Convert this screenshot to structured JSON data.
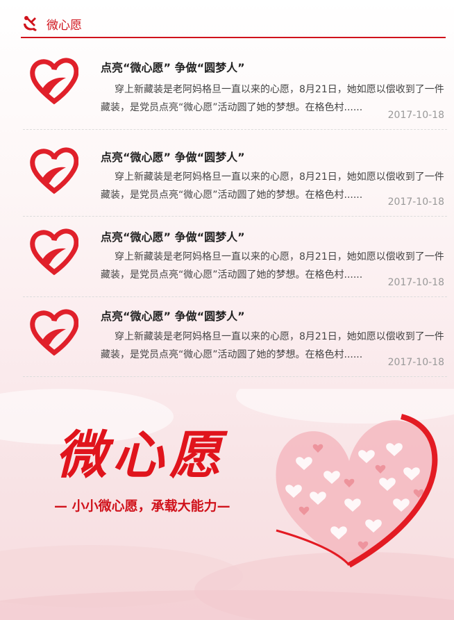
{
  "header": {
    "title": "微心愿",
    "icon": "party-emblem-icon",
    "accent": "#d0121b"
  },
  "items": [
    {
      "title": "点亮“微心愿” 争做“圆梦人”",
      "desc": "穿上新藏装是老阿妈格旦一直以来的心愿，8月21日，她如愿以偿收到了一件藏装，是党员点亮“微心愿”活动圆了她的梦想。在格色村......",
      "date": "2017-10-18",
      "icon": "heart-hand-logo-icon"
    },
    {
      "title": "点亮“微心愿” 争做“圆梦人”",
      "desc": "穿上新藏装是老阿妈格旦一直以来的心愿，8月21日，她如愿以偿收到了一件藏装，是党员点亮“微心愿”活动圆了她的梦想。在格色村......",
      "date": "2017-10-18",
      "icon": "heart-hand-logo-icon"
    },
    {
      "title": "点亮“微心愿” 争做“圆梦人”",
      "desc": "穿上新藏装是老阿妈格旦一直以来的心愿，8月21日，她如愿以偿收到了一件藏装，是党员点亮“微心愿”活动圆了她的梦想。在格色村......",
      "date": "2017-10-18",
      "icon": "heart-hand-logo-icon"
    },
    {
      "title": "点亮“微心愿” 争做“圆梦人”",
      "desc": "穿上新藏装是老阿妈格旦一直以来的心愿，8月21日，她如愿以偿收到了一件藏装，是党员点亮“微心愿”活动圆了她的梦想。在格色村......",
      "date": "2017-10-18",
      "icon": "heart-hand-logo-icon"
    }
  ],
  "banner": {
    "title": "微心愿",
    "slogan": "— 小小微心愿，承载大能力—",
    "icon": "heart-pattern-icon"
  }
}
